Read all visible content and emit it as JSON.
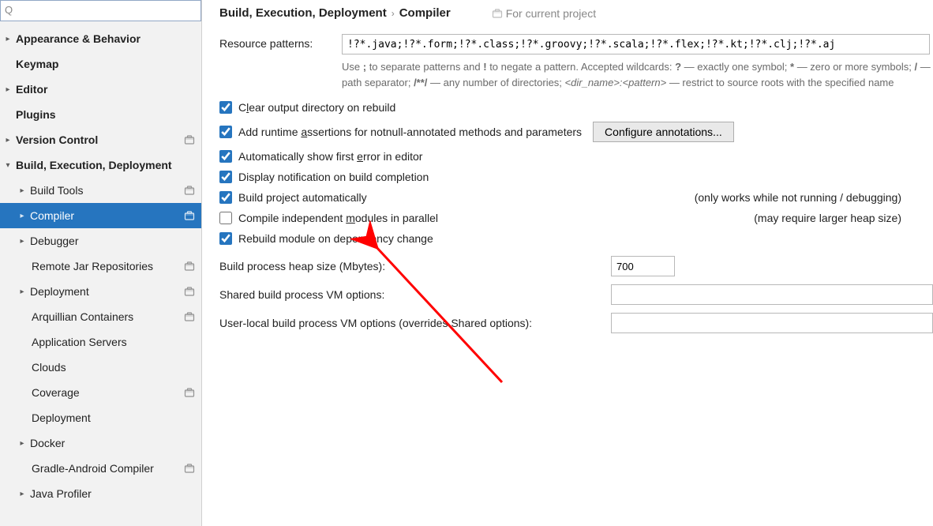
{
  "search": {
    "placeholder": ""
  },
  "sidebar": {
    "items": [
      {
        "label": "Appearance & Behavior",
        "bold": true,
        "level": 0,
        "expand": ">",
        "proj": false
      },
      {
        "label": "Keymap",
        "bold": true,
        "level": 0,
        "expand": "",
        "proj": false
      },
      {
        "label": "Editor",
        "bold": true,
        "level": 0,
        "expand": ">",
        "proj": false
      },
      {
        "label": "Plugins",
        "bold": true,
        "level": 0,
        "expand": "",
        "proj": false
      },
      {
        "label": "Version Control",
        "bold": true,
        "level": 0,
        "expand": ">",
        "proj": true
      },
      {
        "label": "Build, Execution, Deployment",
        "bold": true,
        "level": 0,
        "expand": "v",
        "proj": false
      },
      {
        "label": "Build Tools",
        "bold": false,
        "level": 1,
        "expand": ">",
        "proj": true
      },
      {
        "label": "Compiler",
        "bold": false,
        "level": 1,
        "expand": ">",
        "proj": true,
        "selected": true
      },
      {
        "label": "Debugger",
        "bold": false,
        "level": 1,
        "expand": ">",
        "proj": false
      },
      {
        "label": "Remote Jar Repositories",
        "bold": false,
        "level": 2,
        "expand": "",
        "proj": true
      },
      {
        "label": "Deployment",
        "bold": false,
        "level": 1,
        "expand": ">",
        "proj": true
      },
      {
        "label": "Arquillian Containers",
        "bold": false,
        "level": 2,
        "expand": "",
        "proj": true
      },
      {
        "label": "Application Servers",
        "bold": false,
        "level": 2,
        "expand": "",
        "proj": false
      },
      {
        "label": "Clouds",
        "bold": false,
        "level": 2,
        "expand": "",
        "proj": false
      },
      {
        "label": "Coverage",
        "bold": false,
        "level": 2,
        "expand": "",
        "proj": true
      },
      {
        "label": "Deployment",
        "bold": false,
        "level": 2,
        "expand": "",
        "proj": false
      },
      {
        "label": "Docker",
        "bold": false,
        "level": 1,
        "expand": ">",
        "proj": false
      },
      {
        "label": "Gradle-Android Compiler",
        "bold": false,
        "level": 2,
        "expand": "",
        "proj": true
      },
      {
        "label": "Java Profiler",
        "bold": false,
        "level": 1,
        "expand": ">",
        "proj": false
      }
    ]
  },
  "breadcrumb": {
    "a": "Build, Execution, Deployment",
    "b": "Compiler",
    "badge": "For current project"
  },
  "resource": {
    "label": "Resource patterns:",
    "value": "!?*.java;!?*.form;!?*.class;!?*.groovy;!?*.scala;!?*.flex;!?*.kt;!?*.clj;!?*.aj",
    "help_a": "Use ",
    "help_b": " to separate patterns and ",
    "help_c": " to negate a pattern. Accepted wildcards: ",
    "help_d": " — exactly one symbol; ",
    "help_e": " — zero or more symbols; ",
    "help_f": " — path separator; ",
    "help_g": " — any number of directories; ",
    "help_h": " — restrict to source roots with the specified name",
    "sym_semi": ";",
    "sym_bang": "!",
    "sym_q": "?",
    "sym_star": "*",
    "sym_slash": "/",
    "sym_dstar": "/**/",
    "sym_dir": "<dir_name>:<pattern>"
  },
  "checks": {
    "clear": {
      "pre": "C",
      "ul": "l",
      "post": "ear output directory on rebuild",
      "checked": true
    },
    "runtime": {
      "pre": "Add runtime ",
      "ul": "a",
      "post": "ssertions for notnull-annotated methods and parameters",
      "checked": true,
      "btn_pre": "C",
      "btn_ul": "o",
      "btn_post": "nfigure annotations..."
    },
    "auto_err": {
      "pre": "Automatically show first ",
      "ul": "e",
      "post": "rror in editor",
      "checked": true
    },
    "notif": {
      "pre": "Display notification on build completion",
      "checked": true
    },
    "autobuild": {
      "pre": "Build project automatically",
      "checked": true,
      "hint": "(only works while not running / debugging)"
    },
    "parallel": {
      "pre": "Compile independent ",
      "ul": "m",
      "post": "odules in parallel",
      "checked": false,
      "hint": "(may require larger heap size)"
    },
    "rebuild_dep": {
      "pre": "Rebuild module on dependency change",
      "checked": true
    }
  },
  "fields": {
    "heap": {
      "label": "Build process heap size (Mbytes):",
      "value": "700"
    },
    "shared": {
      "label": "Shared build process VM options:",
      "value": ""
    },
    "user": {
      "label": "User-local build process VM options (overrides Shared options):",
      "value": ""
    }
  }
}
